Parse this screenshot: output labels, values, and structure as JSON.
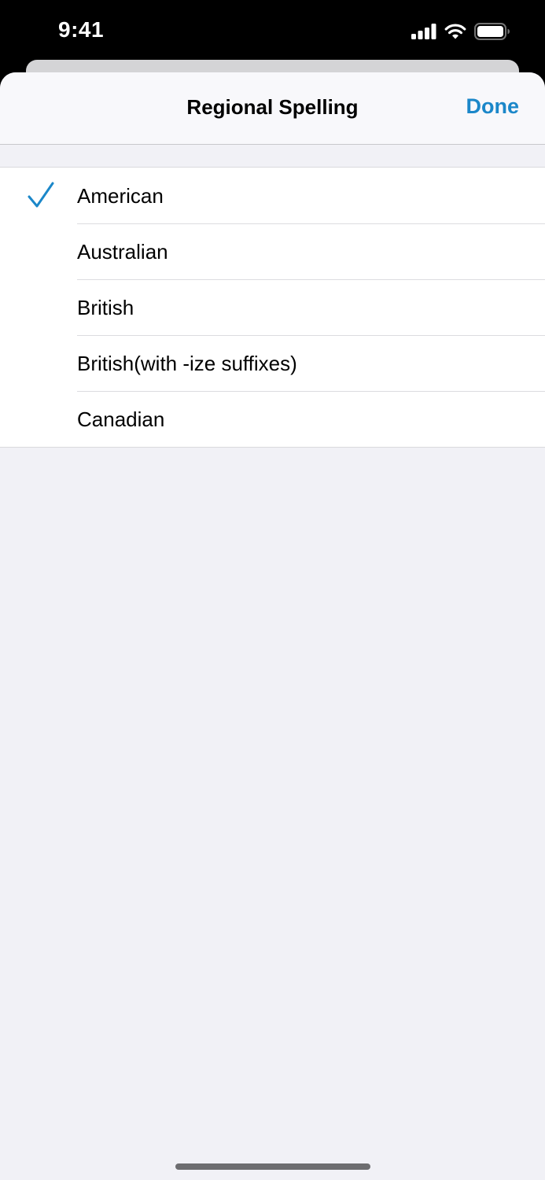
{
  "status_bar": {
    "time": "9:41",
    "icons": [
      "cellular-signal-icon",
      "wifi-icon",
      "battery-icon"
    ]
  },
  "nav": {
    "title": "Regional Spelling",
    "done_label": "Done"
  },
  "options": [
    {
      "label": "American",
      "selected": true
    },
    {
      "label": "Australian",
      "selected": false
    },
    {
      "label": "British",
      "selected": false
    },
    {
      "label": "British(with -ize suffixes)",
      "selected": false
    },
    {
      "label": "Canadian",
      "selected": false
    }
  ],
  "colors": {
    "accent": "#1b87c9",
    "grouped_background": "#f1f1f6",
    "nav_background": "#f8f8fb",
    "cell_background": "#ffffff"
  }
}
